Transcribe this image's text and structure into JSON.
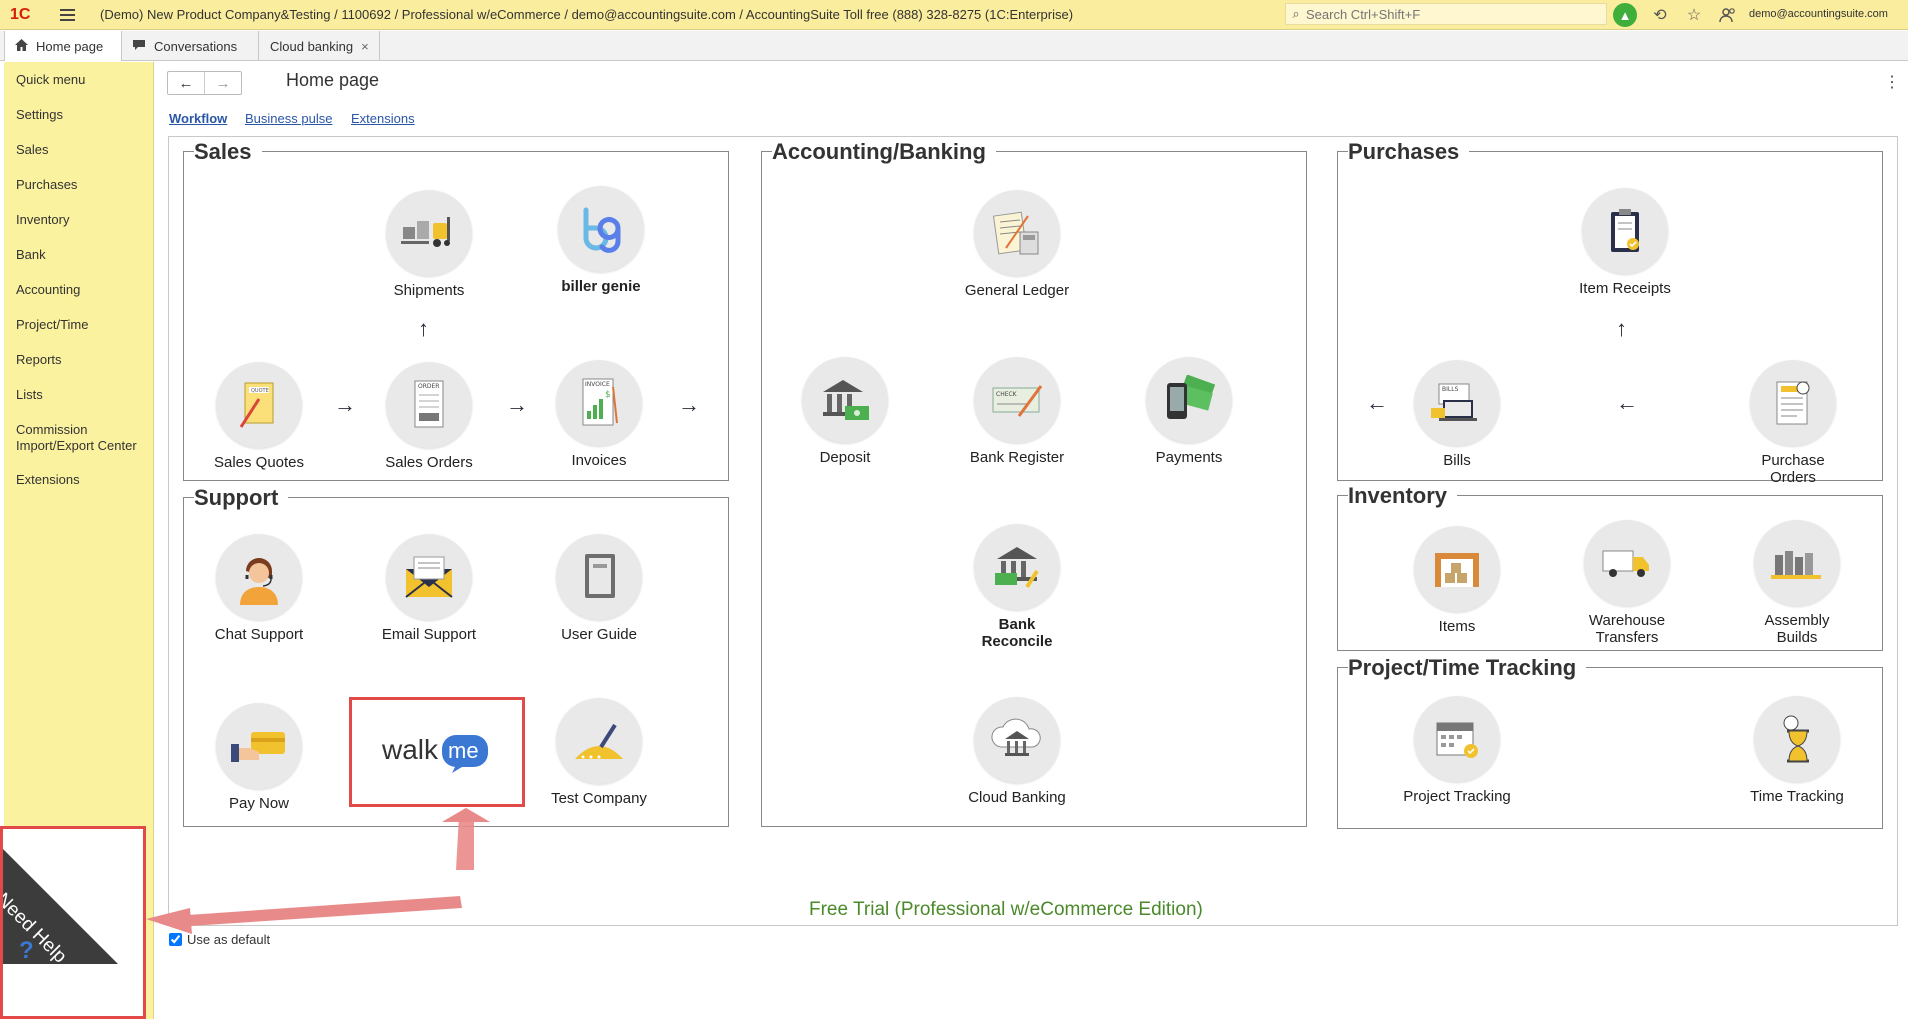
{
  "app": {
    "logo_text": "1C",
    "title": "(Demo) New Product Company&Testing / 1100692 / Professional w/eCommerce / demo@accountingsuite.com / AccountingSuite Toll free (888) 328-8275  (1C:Enterprise)",
    "search_placeholder": "Search Ctrl+Shift+F",
    "user_email": "demo@accountingsuite.com"
  },
  "tabs": [
    {
      "label": "Home page",
      "icon": "home-icon"
    },
    {
      "label": "Conversations",
      "icon": "chat-icon"
    },
    {
      "label": "Cloud banking",
      "close": "×"
    }
  ],
  "sidebar": {
    "items": [
      {
        "label": "Quick menu"
      },
      {
        "label": "Settings"
      },
      {
        "label": "Sales"
      },
      {
        "label": "Purchases"
      },
      {
        "label": "Inventory"
      },
      {
        "label": "Bank"
      },
      {
        "label": "Accounting"
      },
      {
        "label": "Project/Time"
      },
      {
        "label": "Reports"
      },
      {
        "label": "Lists"
      },
      {
        "label": "Commission Import/Export Center"
      },
      {
        "label": "Extensions"
      }
    ]
  },
  "page": {
    "title": "Home page",
    "links": [
      "Workflow",
      "Business pulse",
      "Extensions"
    ],
    "free_trial": "Free Trial (Professional w/eCommerce Edition)",
    "use_default": "Use as default",
    "use_default_checked": true
  },
  "sales": {
    "title": "Sales",
    "tiles": {
      "shipments": "Shipments",
      "biller_genie": "biller genie",
      "sales_quotes": "Sales Quotes",
      "sales_orders": "Sales Orders",
      "invoices": "Invoices"
    }
  },
  "accounting": {
    "title": "Accounting/Banking",
    "tiles": {
      "general_ledger": "General Ledger",
      "deposit": "Deposit",
      "bank_register": "Bank Register",
      "payments": "Payments",
      "bank_reconcile": "Bank Reconcile",
      "cloud_banking": "Cloud Banking"
    }
  },
  "purchases": {
    "title": "Purchases",
    "tiles": {
      "item_receipts": "Item Receipts",
      "bills": "Bills",
      "purchase_orders": "Purchase Orders"
    }
  },
  "support": {
    "title": "Support",
    "tiles": {
      "chat_support": "Chat Support",
      "email_support": "Email Support",
      "user_guide": "User Guide",
      "pay_now": "Pay Now",
      "walkme": "walkme",
      "test_company": "Test Company"
    }
  },
  "inventory": {
    "title": "Inventory",
    "tiles": {
      "items": "Items",
      "warehouse_transfers": "Warehouse Transfers",
      "assembly_builds": "Assembly Builds"
    }
  },
  "project": {
    "title": "Project/Time Tracking",
    "tiles": {
      "project_tracking": "Project Tracking",
      "time_tracking": "Time Tracking"
    }
  },
  "help": {
    "label": "Need Help",
    "icon": "question-icon"
  },
  "colors": {
    "topbar": "#fbed9e",
    "sidebar": "#fbf2a0",
    "link": "#2a56a8",
    "free_trial": "#4a8a2a",
    "annotation": "#e24a4a"
  }
}
